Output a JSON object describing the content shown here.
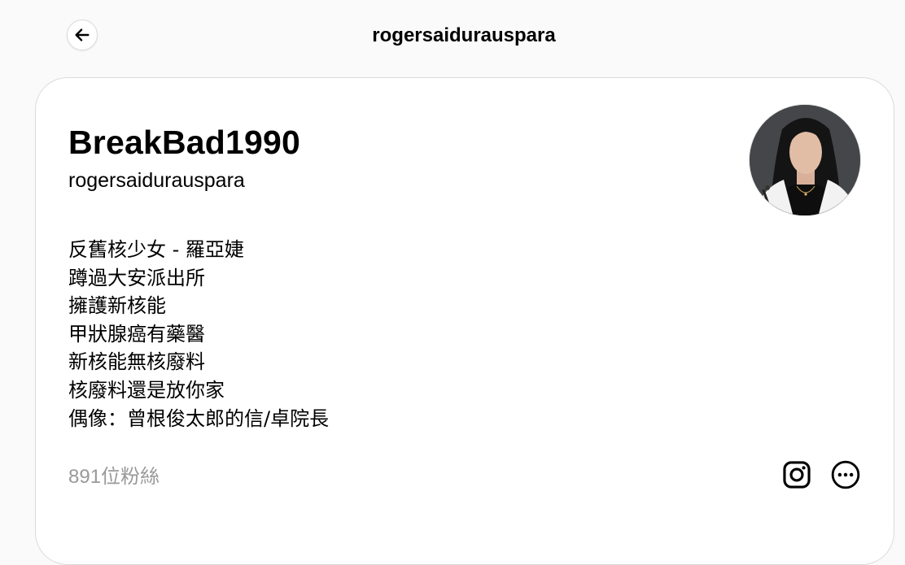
{
  "header": {
    "title": "rogersaidurauspara"
  },
  "profile": {
    "display_name": "BreakBad1990",
    "username": "rogersaidurauspara",
    "bio_lines": [
      "反舊核少女 - 羅亞婕",
      "蹲過大安派出所",
      "擁護新核能",
      "甲狀腺癌有藥醫",
      "新核能無核廢料",
      "核廢料還是放你家",
      "偶像：曾根俊太郎的信/卓院長"
    ],
    "followers": "891位粉絲"
  },
  "icons": {
    "back": "arrow-left-icon",
    "instagram": "instagram-icon",
    "more": "more-options-icon"
  },
  "colors": {
    "background": "#fafafa",
    "card": "#ffffff",
    "border": "#dbdbdb",
    "muted_text": "#999999"
  }
}
